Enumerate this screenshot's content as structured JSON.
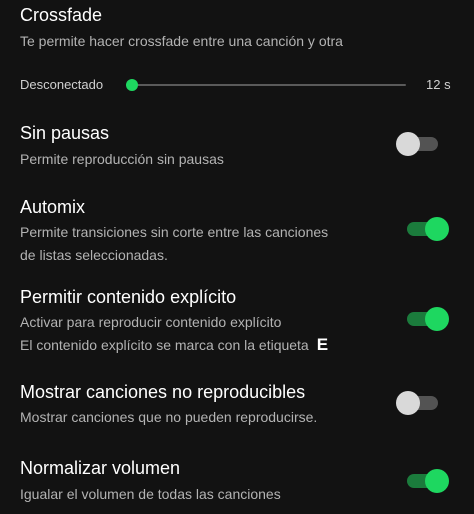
{
  "crossfade": {
    "title": "Crossfade",
    "description": "Te permite hacer crossfade entre una canción y otra",
    "slider_min_label": "Desconectado",
    "slider_max_label": "12 s",
    "slider_value_fraction": 0
  },
  "gapless": {
    "title": "Sin pausas",
    "description": "Permite reproducción sin pausas",
    "enabled": false
  },
  "automix": {
    "title": "Automix",
    "description_line1": "Permite transiciones sin corte entre las canciones",
    "description_line2": "de listas seleccionadas.",
    "enabled": true
  },
  "explicit": {
    "title": "Permitir contenido explícito",
    "description_line1": "Activar para reproducir contenido explícito",
    "description_line2": "El contenido explícito se marca con la etiqueta",
    "badge": "E",
    "enabled": true
  },
  "unplayable": {
    "title": "Mostrar canciones no reproducibles",
    "description": "Mostrar canciones que no pueden reproducirse.",
    "enabled": false
  },
  "normalize": {
    "title": "Normalizar volumen",
    "description": "Igualar el volumen de todas las canciones",
    "enabled": true
  },
  "colors": {
    "accent": "#1ed760",
    "background": "#121212",
    "secondary_text": "#b3b3b3"
  }
}
